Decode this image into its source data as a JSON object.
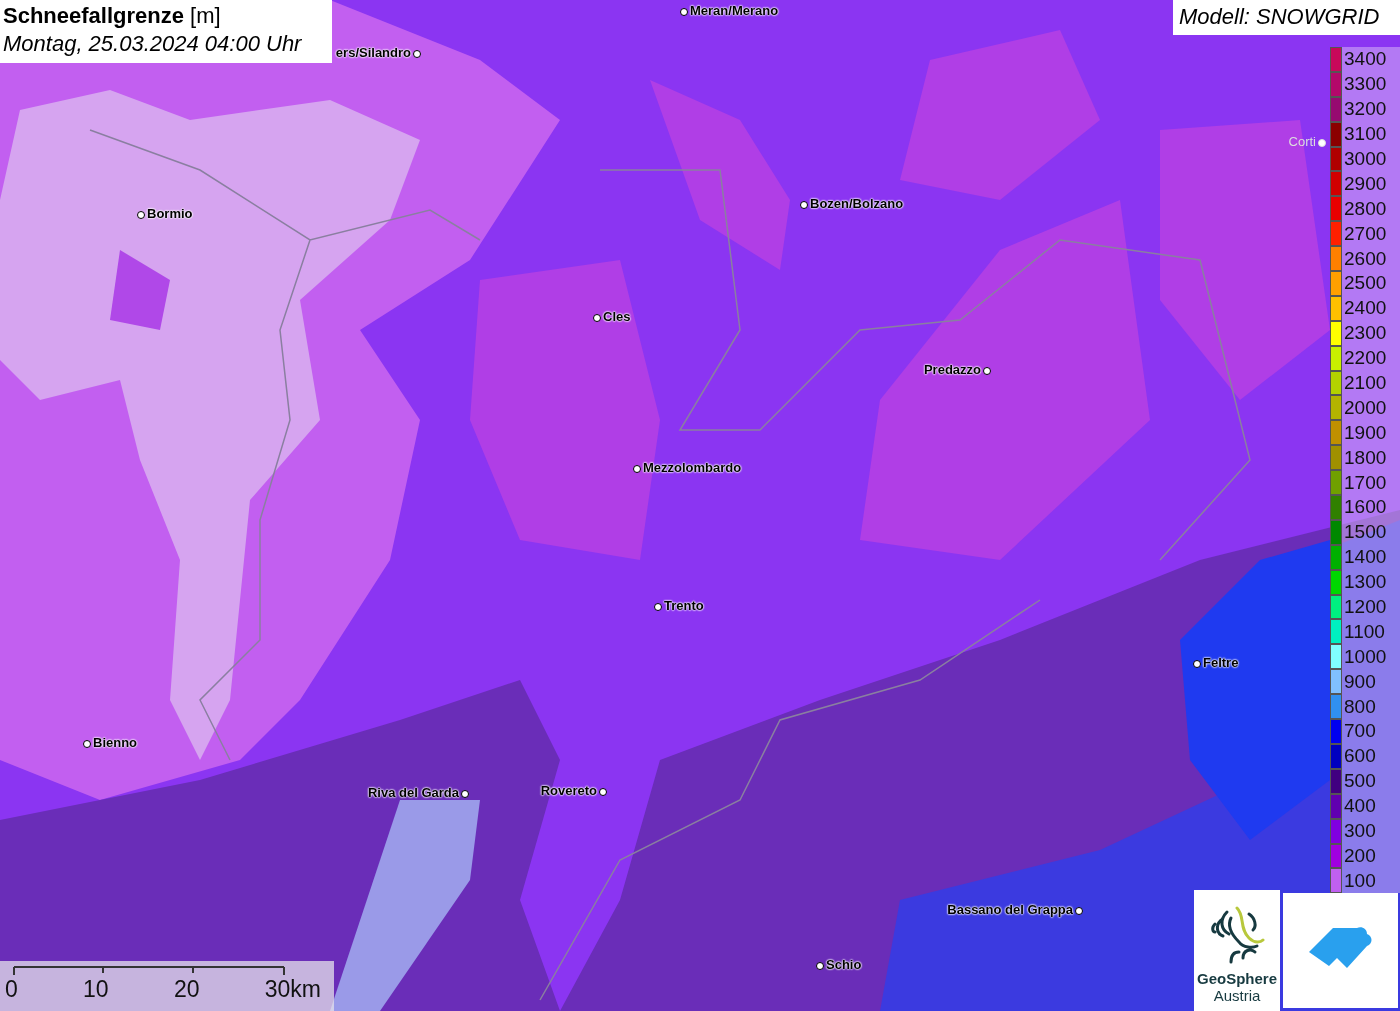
{
  "title": {
    "name": "Schneefallgrenze",
    "unit": "[m]",
    "datetime": "Montag, 25.03.2024 04:00 Uhr"
  },
  "model": "Modell: SNOWGRID",
  "places": [
    {
      "name": "Meran/Merano"
    },
    {
      "name": "ers/Silandro"
    },
    {
      "name": "Bormio"
    },
    {
      "name": "Bozen/Bolzano"
    },
    {
      "name": "Cles"
    },
    {
      "name": "Predazzo"
    },
    {
      "name": "Mezzolombardo"
    },
    {
      "name": "Trento"
    },
    {
      "name": "Feltre"
    },
    {
      "name": "Bienno"
    },
    {
      "name": "Riva del Garda"
    },
    {
      "name": "Rovereto"
    },
    {
      "name": "Bassano del Grappa"
    },
    {
      "name": "Schio"
    },
    {
      "name": "Corti"
    }
  ],
  "legend": [
    {
      "label": "3400",
      "color": "#c8085a"
    },
    {
      "label": "3300",
      "color": "#b4086a"
    },
    {
      "label": "3200",
      "color": "#960a70"
    },
    {
      "label": "3100",
      "color": "#8b0000"
    },
    {
      "label": "3000",
      "color": "#b00000"
    },
    {
      "label": "2900",
      "color": "#d00000"
    },
    {
      "label": "2800",
      "color": "#e80000"
    },
    {
      "label": "2700",
      "color": "#ff2000"
    },
    {
      "label": "2600",
      "color": "#ff8000"
    },
    {
      "label": "2500",
      "color": "#ffa000"
    },
    {
      "label": "2400",
      "color": "#ffc000"
    },
    {
      "label": "2300",
      "color": "#ffff00"
    },
    {
      "label": "2200",
      "color": "#c8f000"
    },
    {
      "label": "2100",
      "color": "#b4d200"
    },
    {
      "label": "2000",
      "color": "#b4b400"
    },
    {
      "label": "1900",
      "color": "#c09000"
    },
    {
      "label": "1800",
      "color": "#a09000"
    },
    {
      "label": "1700",
      "color": "#70a000"
    },
    {
      "label": "1600",
      "color": "#308000"
    },
    {
      "label": "1500",
      "color": "#008800"
    },
    {
      "label": "1400",
      "color": "#00b000"
    },
    {
      "label": "1300",
      "color": "#00d800"
    },
    {
      "label": "1200",
      "color": "#00f080"
    },
    {
      "label": "1100",
      "color": "#00f0c0"
    },
    {
      "label": "1000",
      "color": "#80ffff"
    },
    {
      "label": "900",
      "color": "#80c0ff"
    },
    {
      "label": "800",
      "color": "#3090f0"
    },
    {
      "label": "700",
      "color": "#0000f0"
    },
    {
      "label": "600",
      "color": "#0000c0"
    },
    {
      "label": "500",
      "color": "#400080"
    },
    {
      "label": "400",
      "color": "#6000b0"
    },
    {
      "label": "300",
      "color": "#8000e0"
    },
    {
      "label": "200",
      "color": "#a000e0"
    },
    {
      "label": "100",
      "color": "#c060f0"
    }
  ],
  "scale": [
    "0",
    "10",
    "20",
    "30km"
  ],
  "logo": {
    "name": "GeoSphere",
    "country": "Austria"
  }
}
